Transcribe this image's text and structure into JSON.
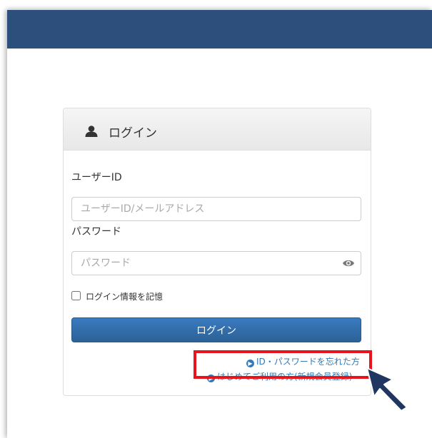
{
  "panel": {
    "title": "ログイン"
  },
  "userid": {
    "label": "ユーザーID",
    "placeholder": "ユーザーID/メールアドレス",
    "value": ""
  },
  "password": {
    "label": "パスワード",
    "placeholder": "パスワード",
    "value": ""
  },
  "remember": {
    "label": "ログイン情報を記憶",
    "checked": false
  },
  "login_button": {
    "label": "ログイン"
  },
  "links": {
    "forgot": "ID・パスワードを忘れた方",
    "register": "はじめてご利用の方(新規会員登録)"
  },
  "icons": {
    "user": "user-icon",
    "eye": "eye-icon",
    "link_arrow": "circle-arrow-right-icon",
    "pointer": "mouse-pointer-icon"
  },
  "colors": {
    "topbar": "#2d4f7c",
    "button": "#2c6196",
    "link": "#337ab7",
    "highlight": "#e8141b",
    "pointer": "#1f3760"
  }
}
